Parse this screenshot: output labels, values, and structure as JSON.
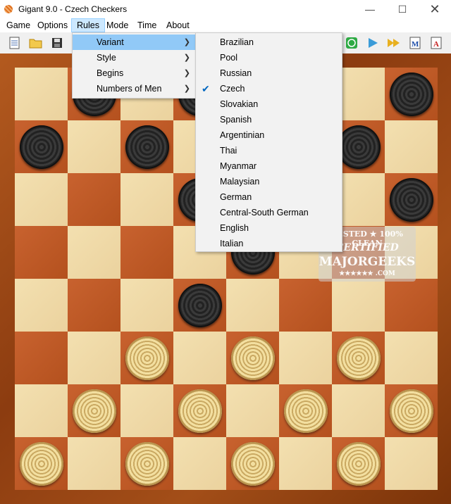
{
  "window": {
    "title": "Gigant 9.0 - Czech Checkers"
  },
  "menubar": {
    "items": [
      "Game",
      "Options",
      "Rules",
      "Mode",
      "Time",
      "About"
    ],
    "active": "Rules"
  },
  "rules_menu": {
    "items": [
      "Variant",
      "Style",
      "Begins",
      "Numbers of Men"
    ],
    "highlighted": "Variant"
  },
  "variant_menu": {
    "items": [
      "Brazilian",
      "Pool",
      "Russian",
      "Czech",
      "Slovakian",
      "Spanish",
      "Argentinian",
      "Thai",
      "Myanmar",
      "Malaysian",
      "German",
      "Central-South German",
      "English",
      "Italian"
    ],
    "checked": "Czech"
  },
  "toolbar": {
    "icons": [
      "new-game-icon",
      "open-folder-icon",
      "save-icon",
      "play-green-icon",
      "play-blue-icon",
      "fast-forward-icon",
      "m-document-icon",
      "a-document-icon"
    ]
  },
  "board": {
    "size": 8,
    "dark_pieces": [
      [
        0,
        1
      ],
      [
        0,
        3
      ],
      [
        0,
        7
      ],
      [
        1,
        0
      ],
      [
        1,
        2
      ],
      [
        1,
        6
      ],
      [
        2,
        3
      ],
      [
        2,
        7
      ],
      [
        3,
        4
      ],
      [
        4,
        3
      ]
    ],
    "light_pieces": [
      [
        5,
        2
      ],
      [
        5,
        4
      ],
      [
        5,
        6
      ],
      [
        6,
        1
      ],
      [
        6,
        3
      ],
      [
        6,
        5
      ],
      [
        6,
        7
      ],
      [
        7,
        0
      ],
      [
        7,
        2
      ],
      [
        7,
        4
      ],
      [
        7,
        6
      ]
    ]
  },
  "watermark": {
    "line1": "TESTED ★ 100% CLEAN",
    "line2": "CERTIFIED",
    "line3": "MAJORGEEKS",
    "line4": "★★★★★★ .COM"
  },
  "colors": {
    "light_square": "#f3e0b0",
    "dark_square": "#c8622f",
    "frame": "#8c3c10",
    "menu_highlight": "#91c9f7"
  }
}
